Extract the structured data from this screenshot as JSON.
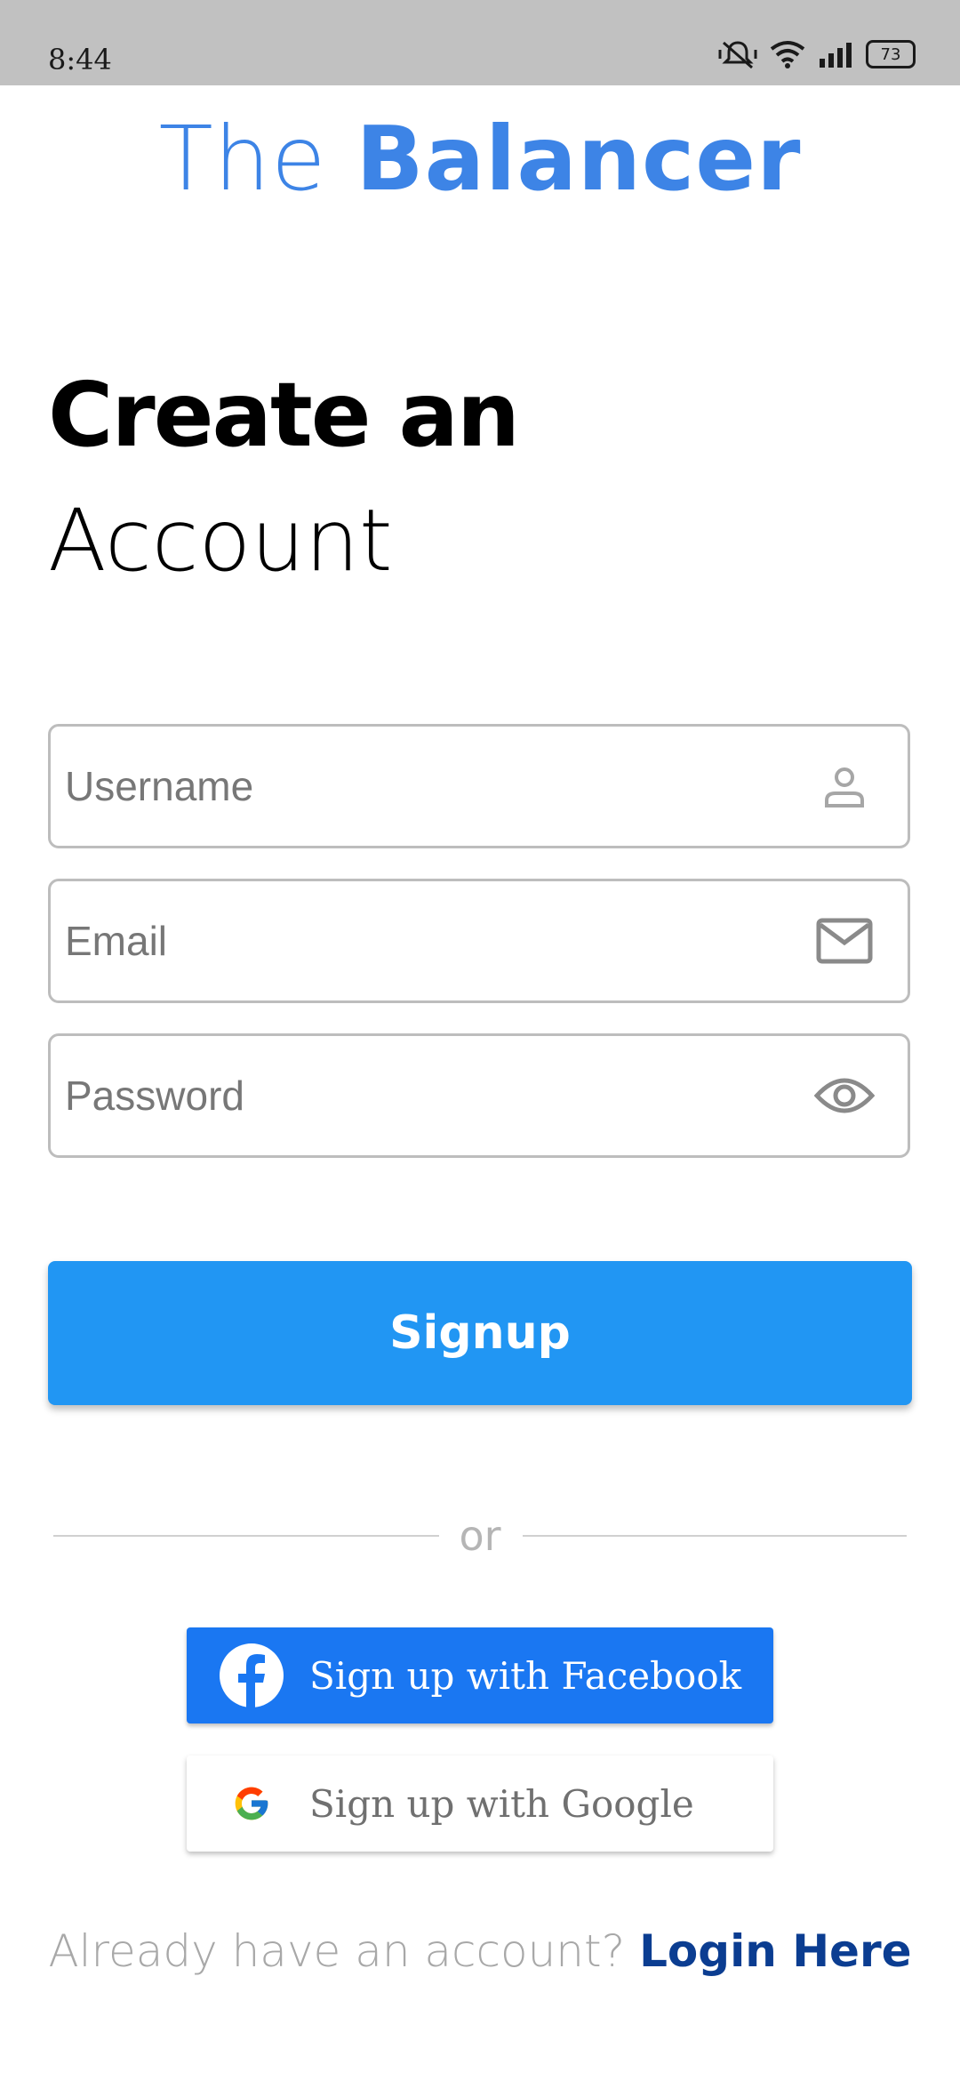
{
  "status": {
    "time": "8:44",
    "battery": "73"
  },
  "app": {
    "title_light": "The",
    "title_bold": "Balancer",
    "brand_color": "#3d84e6"
  },
  "heading": {
    "line1": "Create an",
    "line2": "Account"
  },
  "form": {
    "username": {
      "placeholder": "Username",
      "value": "",
      "icon": "person-icon"
    },
    "email": {
      "placeholder": "Email",
      "value": "",
      "icon": "mail-icon"
    },
    "password": {
      "placeholder": "Password",
      "value": "",
      "icon": "eye-icon"
    }
  },
  "actions": {
    "signup_label": "Signup",
    "signup_color": "#2196f3",
    "or_label": "or",
    "facebook_label": "Sign up with Facebook",
    "facebook_color": "#1a77f2",
    "google_label": "Sign up with Google"
  },
  "footer": {
    "prompt": "Already have an account?",
    "login_label": "Login Here"
  }
}
